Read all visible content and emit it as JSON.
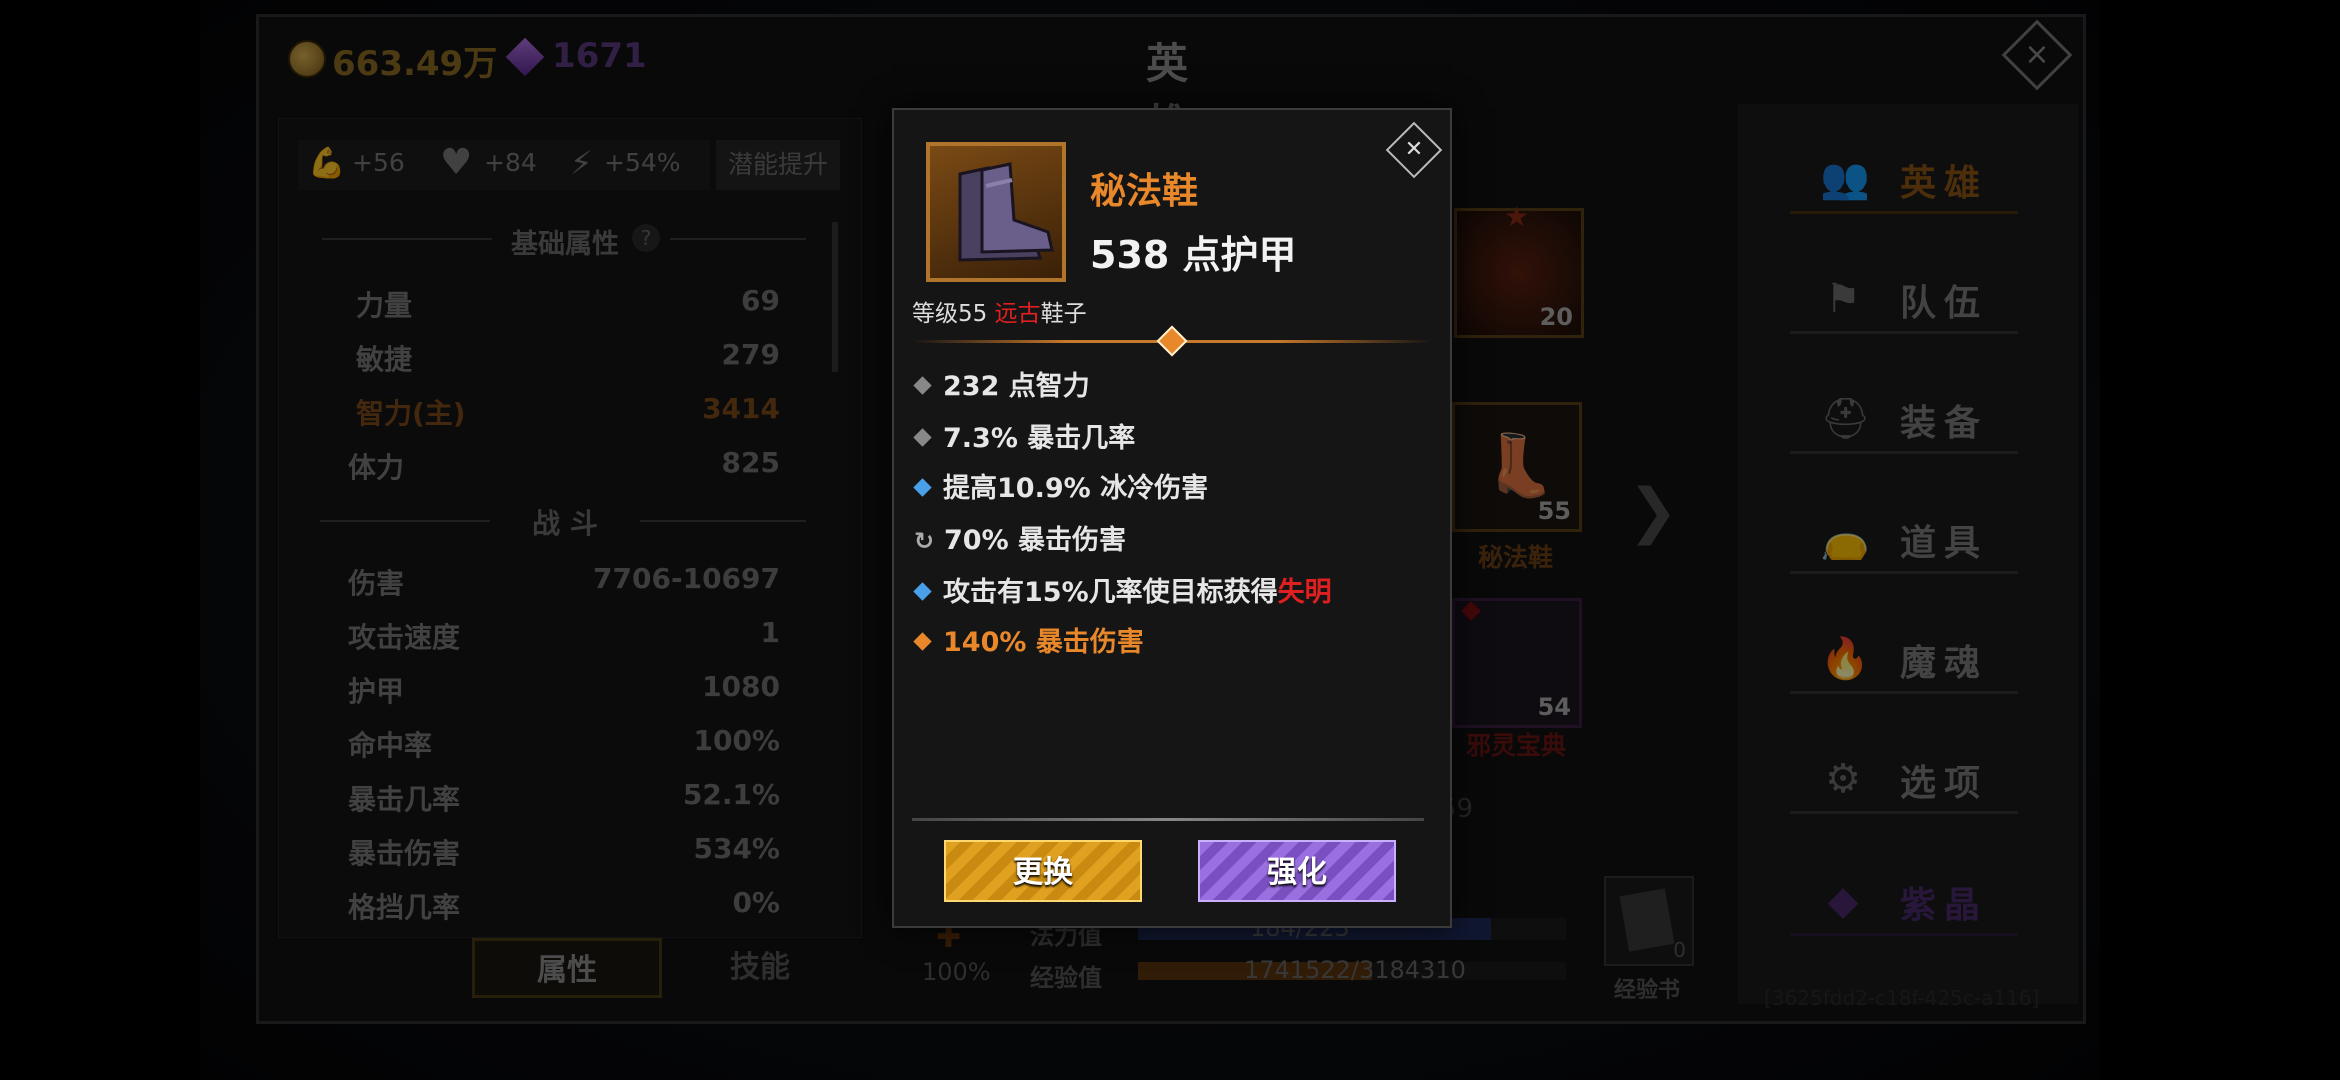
{
  "top_bar": {
    "gold": "663.49万",
    "gems": "1671",
    "title": "英 雄"
  },
  "stat_boosts": {
    "strength_boost": "+56",
    "health_boost": "+84",
    "energy_boost": "+54%",
    "potential_button": "潜能提升"
  },
  "attributes": {
    "basic_header": "基础属性",
    "help": "?",
    "rows": [
      {
        "label": "力量",
        "value": "69"
      },
      {
        "label": "敏捷",
        "value": "279"
      },
      {
        "label": "智力(主)",
        "value": "3414"
      },
      {
        "label": "体力",
        "value": "825"
      }
    ],
    "combat_header": "战 斗",
    "combat_rows": [
      {
        "label": "伤害",
        "value": "7706-10697"
      },
      {
        "label": "攻击速度",
        "value": "1"
      },
      {
        "label": "护甲",
        "value": "1080"
      },
      {
        "label": "命中率",
        "value": "100%"
      },
      {
        "label": "暴击几率",
        "value": "52.1%"
      },
      {
        "label": "暴击伤害",
        "value": "534%"
      },
      {
        "label": "格挡几率",
        "value": "0%"
      }
    ]
  },
  "left_tabs": {
    "attributes_tab": "属性",
    "skills_tab": "技能"
  },
  "hero_bottom": {
    "percent": "100%",
    "mana_label": "法力值",
    "mana_value": "184/223",
    "mana_fraction": 0.825,
    "exp_label": "经验值",
    "exp_value": "1741522/3184310",
    "exp_fraction": 0.547,
    "exp_book_label": "经验书",
    "exp_book_count": "0",
    "partial_level": "59",
    "arrow": "❯"
  },
  "equip_slots": [
    {
      "level": "20",
      "name": ""
    },
    {
      "level": "55",
      "name": "秘法鞋"
    },
    {
      "level": "54",
      "name": "邪灵宝典"
    }
  ],
  "nav": [
    {
      "label": "英雄",
      "icon": "heroes-icon"
    },
    {
      "label": "队伍",
      "icon": "flag-icon"
    },
    {
      "label": "装备",
      "icon": "helmet-icon"
    },
    {
      "label": "道具",
      "icon": "bag-icon"
    },
    {
      "label": "魔魂",
      "icon": "flame-icon"
    },
    {
      "label": "选项",
      "icon": "gear-icon"
    },
    {
      "label": "紫晶",
      "icon": "amethyst-icon"
    }
  ],
  "id_watermark": "[3625fdd2-c18f-425c-a116]",
  "popup": {
    "item_name": "秘法鞋",
    "armor": "538 点护甲",
    "level_prefix": "等级55",
    "rarity": "远古",
    "item_type": "鞋子",
    "affixes": [
      {
        "text": "232 点智力",
        "bullet": "gray"
      },
      {
        "text": "7.3% 暴击几率",
        "bullet": "gray"
      },
      {
        "text": "提高10.9% 冰冷伤害",
        "bullet": "blue"
      },
      {
        "text": "70% 暴击伤害",
        "bullet": "reroll"
      },
      {
        "text": "攻击有15%几率使目标获得",
        "highlight": "失明",
        "bullet": "blue"
      },
      {
        "text": "140% 暴击伤害",
        "bullet": "orange"
      }
    ],
    "replace_button": "更换",
    "enhance_button": "强化"
  },
  "colors": {
    "legendary_orange": "#e8882a",
    "ancient_red": "#e02020",
    "magic_blue": "#4aa0e8",
    "gold": "#c8962a",
    "gem_purple": "#8a5ac8"
  }
}
